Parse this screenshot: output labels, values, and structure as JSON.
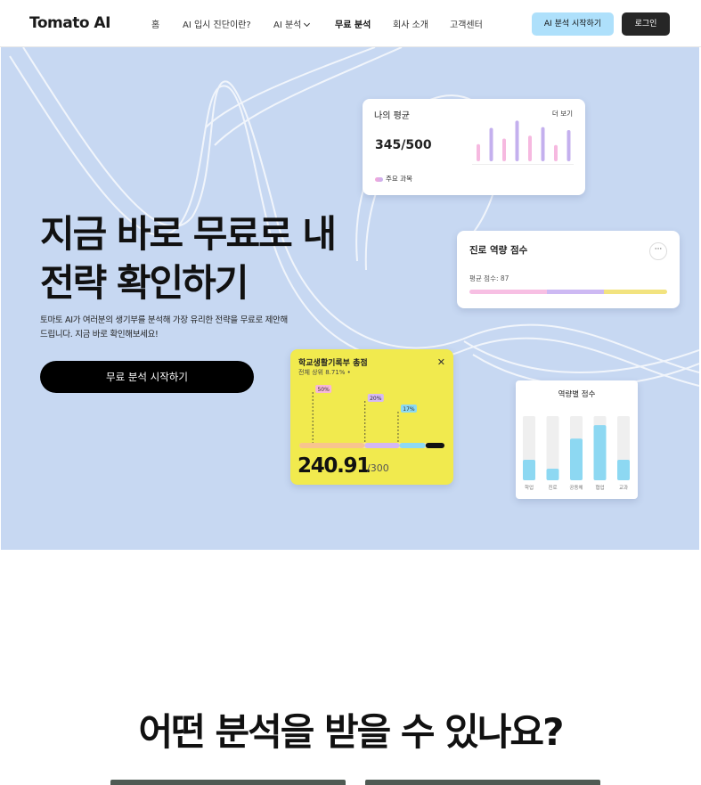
{
  "nav": {
    "logo": "Tomato AI",
    "items": [
      {
        "label": "홈",
        "active": false
      },
      {
        "label": "AI 입시 진단이란?",
        "active": false
      },
      {
        "label": "AI 분석",
        "active": false,
        "has_dropdown": true
      },
      {
        "label": "무료 분석",
        "active": true
      },
      {
        "label": "회사 소개",
        "active": false
      },
      {
        "label": "고객센터",
        "active": false
      }
    ],
    "cta_label": "AI 분석 시작하기",
    "login_label": "로그인"
  },
  "hero": {
    "title_line1": "지금 바로 무료로 내",
    "title_line2": "전략 확인하기",
    "desc_line1": "토마토 AI가 여러분의 생기부를 분석해 가장 유리한 전략을 무료로 제안해",
    "desc_line2": "드립니다. 지금 바로 확인해보세요!",
    "cta_label": "무료 분석 시작하기"
  },
  "avg_card": {
    "title": "나의 평균",
    "more": "더 보기",
    "score": "345/500",
    "legend": "주요 과목",
    "bars": [
      {
        "color": "#f6b9e0",
        "value": 0.4
      },
      {
        "color": "#c4b0ee",
        "value": 0.78
      },
      {
        "color": "#f6b9e0",
        "value": 0.53
      },
      {
        "color": "#c4b0ee",
        "value": 0.95
      },
      {
        "color": "#f6b9e0",
        "value": 0.6
      },
      {
        "color": "#c4b0ee",
        "value": 0.8
      },
      {
        "color": "#f6b9e0",
        "value": 0.38
      },
      {
        "color": "#c4b0ee",
        "value": 0.73
      }
    ]
  },
  "career_card": {
    "title": "진로 역량 점수",
    "more": "···",
    "sub": "평균 점수: 87",
    "segments": [
      {
        "color": "#f7bfe3",
        "share": 0.39
      },
      {
        "color": "#cdb9f3",
        "share": 0.29
      },
      {
        "color": "#f2e37f",
        "share": 0.32
      }
    ]
  },
  "total_card": {
    "title": "학교생활기록부 총점",
    "sub": "전체 상위 8.71% •",
    "close": "✕",
    "score": "240.91",
    "max": "/300",
    "markers": [
      {
        "label": "50%",
        "color": "#f7b7d7",
        "pos": 0.05
      },
      {
        "label": "20%",
        "color": "#d6b9f4",
        "pos": 0.46
      },
      {
        "label": "17%",
        "color": "#8cd9f2",
        "pos": 0.72
      }
    ],
    "segments": [
      {
        "color": "#f8c48e",
        "share": 0.45
      },
      {
        "color": "#d4b7f3",
        "share": 0.24
      },
      {
        "color": "#8ed9f3",
        "share": 0.18
      },
      {
        "color": "#111111",
        "share": 0.13
      }
    ]
  },
  "comp_card": {
    "title": "역량별 점수",
    "fill_color": "#8dd8f2",
    "track_color": "#efefef",
    "bars": [
      {
        "label": "학업",
        "value": 0.32
      },
      {
        "label": "진로",
        "value": 0.18
      },
      {
        "label": "공동체",
        "value": 0.65
      },
      {
        "label": "협업",
        "value": 0.86
      },
      {
        "label": "교과",
        "value": 0.32
      }
    ]
  },
  "section2": {
    "title": "어떤 분석을 받을 수 있나요?"
  }
}
